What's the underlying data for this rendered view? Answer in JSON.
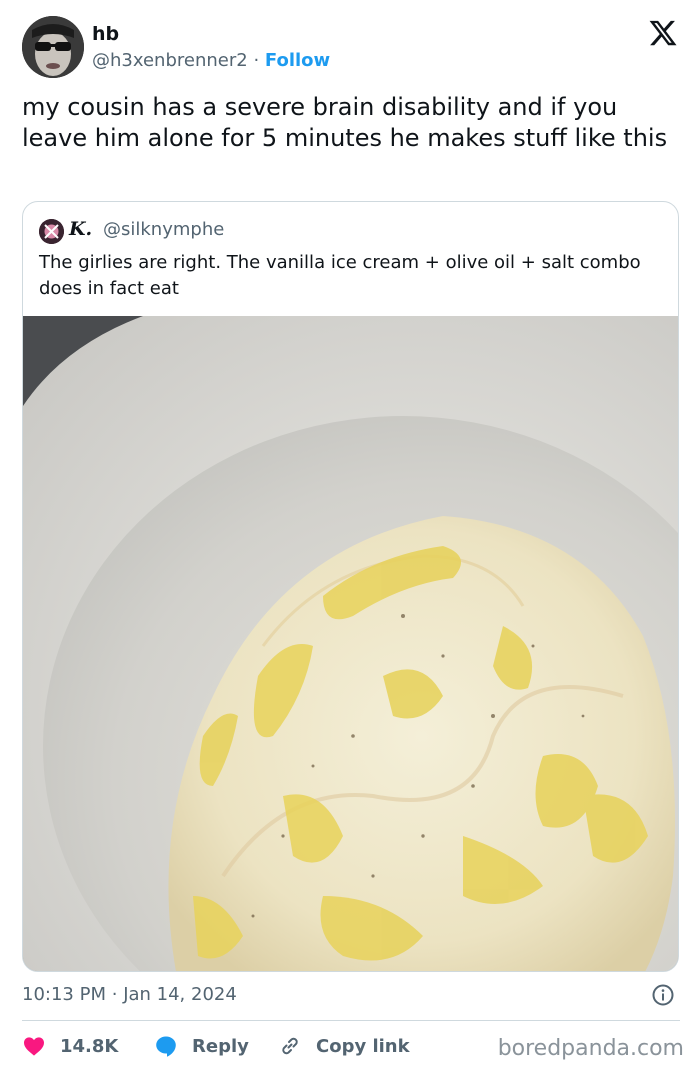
{
  "author": {
    "name": "hb",
    "handle": "@h3xenbrenner2",
    "separator": "·",
    "follow_label": "Follow"
  },
  "tweet": {
    "text": "my cousin has a severe brain disability and if you leave him alone for 5 minutes he makes stuff like this"
  },
  "quote": {
    "name": "K.",
    "handle": "@silknymphe",
    "text": "The girlies are right. The vanilla ice cream + olive oil + salt combo does in fact eat",
    "image_icon": "ice-cream-with-olive-oil-photo"
  },
  "meta": {
    "time": "10:13 PM",
    "separator": "·",
    "date": "Jan 14, 2024"
  },
  "actions": {
    "likes": "14.8K",
    "reply_label": "Reply",
    "copy_link_label": "Copy link"
  },
  "watermark": "boredpanda.com",
  "colors": {
    "accent": "#1d9bf0",
    "like": "#f91880",
    "text": "#0f1419",
    "muted": "#536471"
  },
  "icons": {
    "brand": "x-logo-icon",
    "info": "info-icon",
    "like": "heart-icon",
    "reply": "speech-bubble-icon",
    "copy": "link-icon"
  }
}
